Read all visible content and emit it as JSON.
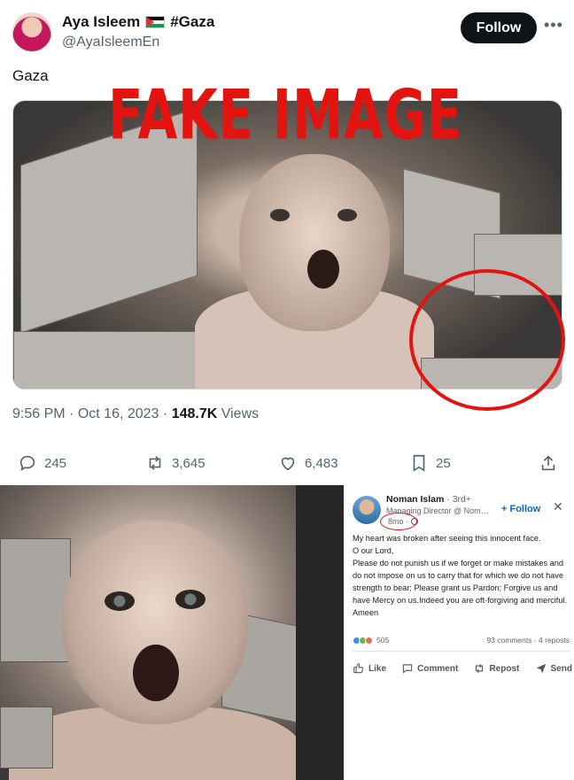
{
  "tweet": {
    "author": {
      "display_name": "Aya Isleem",
      "hashtag": "#Gaza",
      "handle": "@AyaIsleemEn"
    },
    "follow_label": "Follow",
    "text": "Gaza",
    "overlay_text": "FAKE IMAGE",
    "time": "9:56 PM",
    "separator": "·",
    "date": "Oct 16, 2023",
    "views_count": "148.7K",
    "views_label": "Views",
    "actions": {
      "replies": "245",
      "reposts": "3,645",
      "likes": "6,483",
      "bookmarks": "25"
    }
  },
  "linkedin_post": {
    "author_name": "Noman Islam",
    "degree": "· 3rd+",
    "headline": "Managing Director @ Noman ...",
    "follow_label": "+ Follow",
    "time": "8mo ·",
    "body": [
      "My heart was broken after seeing this innocent face.",
      "O our Lord,",
      "Please do not punish us if we forget or make mistakes and do not impose on us to carry that for which we do not have strength to bear; Please grant us Pardon; Forgive us and have Mercy on us.Indeed you are oft-forgiving and merciful.",
      "Ameen"
    ],
    "reaction_count": "505",
    "comments_reposts": "93 comments · 4 reposts",
    "actions": {
      "like": "Like",
      "comment": "Comment",
      "repost": "Repost",
      "send": "Send"
    }
  },
  "colors": {
    "overlay_red": "#e3140f",
    "linkedin_blue": "#0a66c2",
    "muted": "#536471"
  }
}
